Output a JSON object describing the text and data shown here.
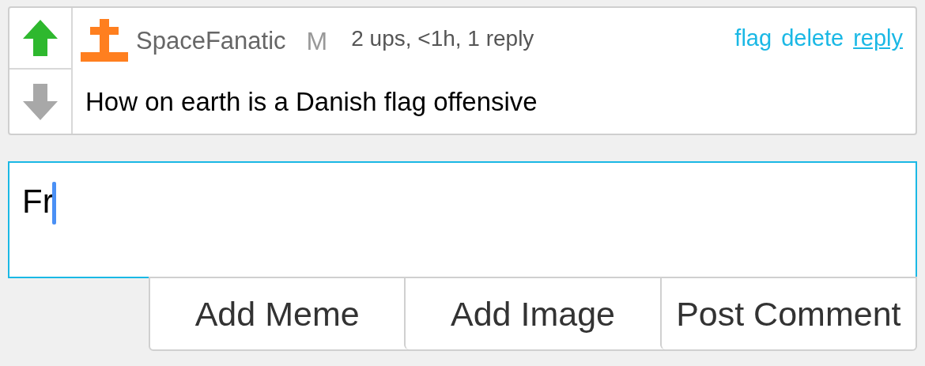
{
  "comment": {
    "upvote": {
      "selected": true
    },
    "downvote": {
      "selected": false
    },
    "username": "SpaceFanatic",
    "badge": "M",
    "meta": "2 ups, <1h, 1 reply",
    "links": [
      {
        "label": "flag",
        "hovered": false
      },
      {
        "label": "delete",
        "hovered": false
      },
      {
        "label": "reply",
        "hovered": true
      }
    ],
    "text": "How on earth is a Danish flag offensive"
  },
  "reply_box": {
    "value": "Fr",
    "focused": true
  },
  "buttons": [
    "Add Meme",
    "Add Image",
    "Post Comment"
  ]
}
